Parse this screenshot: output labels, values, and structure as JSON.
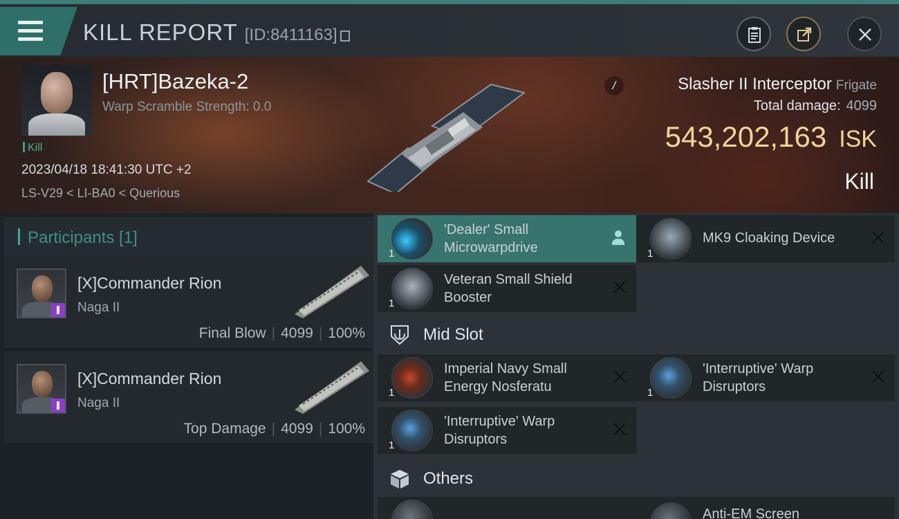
{
  "header": {
    "title": "KILL REPORT",
    "report_id": "[ID:8411163]"
  },
  "victim": {
    "name": "[HRT]Bazeka-2",
    "scramble": "Warp Scramble Strength: 0.0",
    "tag": "Kill",
    "datetime": "2023/04/18 18:41:30 UTC +2",
    "location": "LS-V29 < LI-BA0 < Querious",
    "ship_marker": "/",
    "ship_name": "Slasher II Interceptor",
    "ship_class": "Frigate",
    "total_damage_label": "Total damage:",
    "total_damage": "4099",
    "isk_value": "543,202,163",
    "isk_unit": "ISK",
    "outcome": "Kill"
  },
  "participants": {
    "header": "Participants [1]",
    "rows": [
      {
        "name": "[X]Commander Rion",
        "ship": "Naga II",
        "role": "Final Blow",
        "damage": "4099",
        "percent": "100%"
      },
      {
        "name": "[X]Commander Rion",
        "ship": "Naga II",
        "role": "Top Damage",
        "damage": "4099",
        "percent": "100%"
      }
    ]
  },
  "fitting": {
    "high": [
      {
        "name": "'Dealer' Small Microwarpdrive",
        "qty": "1",
        "icon": "microwarpdrive-icon"
      },
      {
        "name": "MK9 Cloaking Device",
        "qty": "1",
        "icon": "cloaking-device-icon"
      },
      {
        "name": "Veteran Small Shield Booster",
        "qty": "1",
        "icon": "shield-booster-icon"
      }
    ],
    "mid_label": "Mid Slot",
    "mid": [
      {
        "name": "Imperial Navy Small Energy Nosferatu",
        "qty": "1",
        "icon": "energy-nosferatu-icon"
      },
      {
        "name": "'Interruptive' Warp Disruptors",
        "qty": "1",
        "icon": "warp-disruptor-icon"
      },
      {
        "name": "'Interruptive' Warp Disruptors",
        "qty": "",
        "icon": "warp-disruptor-icon"
      }
    ],
    "others_label": "Others",
    "others": [
      {
        "name": "",
        "qty": "",
        "icon": "module-icon"
      },
      {
        "name": "Anti-EM Screen",
        "qty": "",
        "icon": "anti-em-screen-icon"
      }
    ]
  },
  "colors": {
    "accent_teal": "#3b7f78",
    "active_slot": "#38746e",
    "isk_gold": "#f0d49a",
    "corp_purple": "#8b3fc8"
  }
}
